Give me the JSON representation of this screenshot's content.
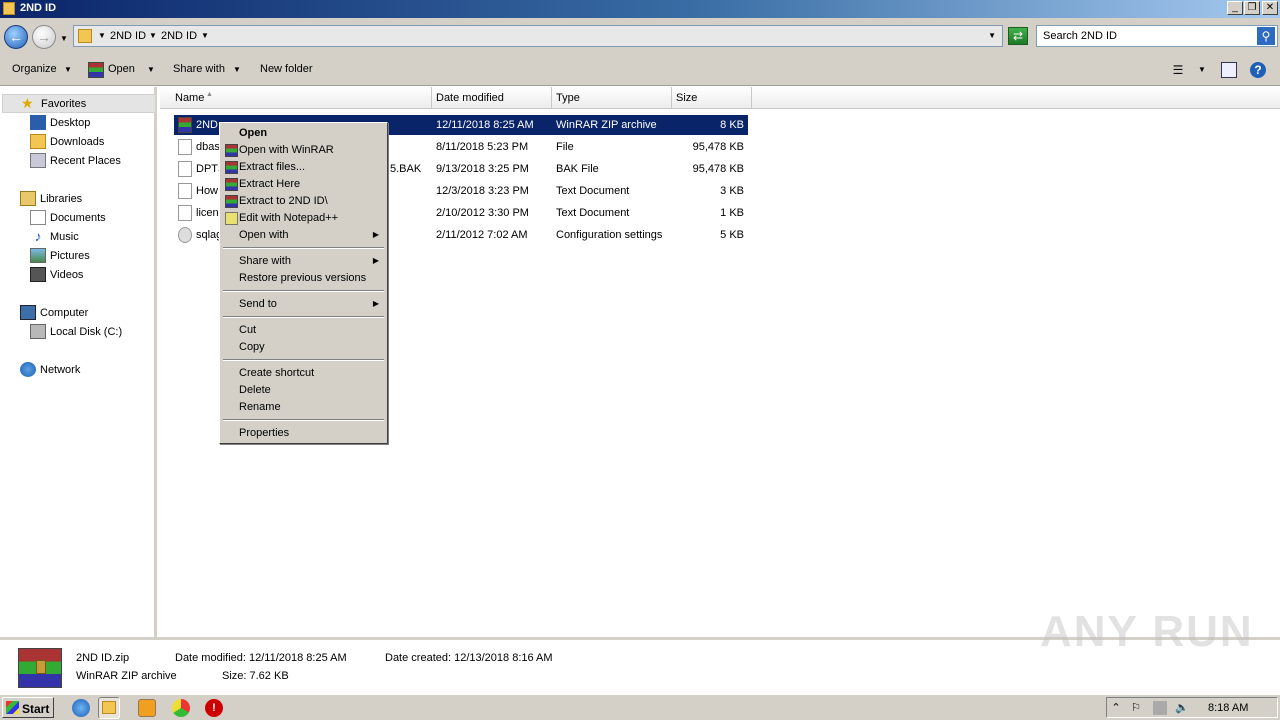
{
  "window": {
    "title": "2ND ID"
  },
  "address": {
    "crumbs": [
      "2ND ID",
      "2ND ID"
    ],
    "search_placeholder": "Search 2ND ID"
  },
  "toolbar": {
    "organize": "Organize",
    "open": "Open",
    "share_with": "Share with",
    "new_folder": "New folder"
  },
  "sidebar": {
    "favorites": "Favorites",
    "desktop": "Desktop",
    "downloads": "Downloads",
    "recent": "Recent Places",
    "libraries": "Libraries",
    "documents": "Documents",
    "music": "Music",
    "pictures": "Pictures",
    "videos": "Videos",
    "computer": "Computer",
    "local_disk": "Local Disk (C:)",
    "network": "Network"
  },
  "columns": {
    "name": "Name",
    "date": "Date modified",
    "type": "Type",
    "size": "Size"
  },
  "files": [
    {
      "name": "2ND",
      "date": "12/11/2018 8:25 AM",
      "type": "WinRAR ZIP archive",
      "size": "8 KB"
    },
    {
      "name": "dbas",
      "date": "8/11/2018 5:23 PM",
      "type": "File",
      "size": "95,478 KB"
    },
    {
      "name": "DPTS",
      "name_tail": "5.BAK",
      "date": "9/13/2018 3:25 PM",
      "type": "BAK File",
      "size": "95,478 KB"
    },
    {
      "name": "How",
      "date": "12/3/2018 3:23 PM",
      "type": "Text Document",
      "size": "3 KB"
    },
    {
      "name": "licen",
      "date": "2/10/2012 3:30 PM",
      "type": "Text Document",
      "size": "1 KB"
    },
    {
      "name": "sqlag",
      "date": "2/11/2012 7:02 AM",
      "type": "Configuration settings",
      "size": "5 KB"
    }
  ],
  "context_menu": {
    "open": "Open",
    "open_winrar": "Open with WinRAR",
    "extract_files": "Extract files...",
    "extract_here": "Extract Here",
    "extract_to": "Extract to 2ND ID\\",
    "edit_npp": "Edit with Notepad++",
    "open_with": "Open with",
    "share_with": "Share with",
    "restore": "Restore previous versions",
    "send_to": "Send to",
    "cut": "Cut",
    "copy": "Copy",
    "create_shortcut": "Create shortcut",
    "delete": "Delete",
    "rename": "Rename",
    "properties": "Properties"
  },
  "details": {
    "filename": "2ND ID.zip",
    "filetype": "WinRAR ZIP archive",
    "date_modified": "Date modified:  12/11/2018 8:25 AM",
    "size": "Size:  7.62 KB",
    "date_created": "Date created:  12/13/2018 8:16 AM"
  },
  "watermark": "ANY RUN",
  "taskbar": {
    "start": "Start",
    "clock": "8:18 AM"
  }
}
